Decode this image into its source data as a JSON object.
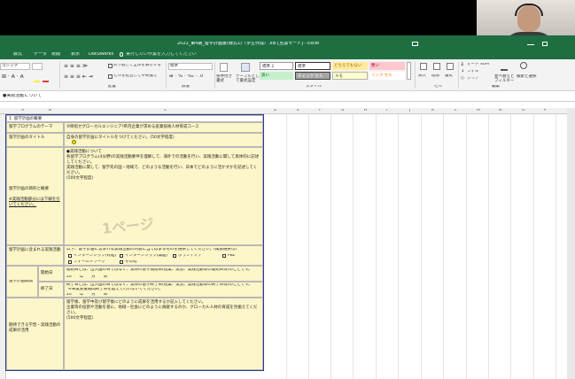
{
  "window_title": "2021_第4期_留学計画書(様式1)（学生作成）.xls [互換モード] - Excel",
  "menu": [
    "数式",
    "データ",
    "校閲",
    "表示",
    "DocuWorks",
    "実行したい作業を入力してください"
  ],
  "ribbon": {
    "font_name": "ゴシック",
    "wrap_text": "折り返して全体を表示する",
    "merge_center": "セルを結合して中央揃え",
    "number_format": "標準",
    "cond_format": "条件付き書式",
    "table_format": "テーブルとして書式設定",
    "styles": [
      "標準 2",
      "標準",
      "どちらでもない",
      "悪い",
      "良い",
      "チェック セル",
      "メモ",
      "リンク セル"
    ],
    "insert": "挿入",
    "delete": "削除",
    "format": "書式",
    "autosum": "オート SUM",
    "fill": "フィル",
    "clear": "クリア",
    "sort_filter": "並べ替えとフィルター",
    "find_select": "検索と選択",
    "groups": [
      "配置",
      "数値",
      "スタイル",
      "セル",
      "編集"
    ]
  },
  "formula_bar": "●実践活動について",
  "columns": [
    "A",
    "B",
    "C",
    "D",
    "E",
    "F",
    "G",
    "H",
    "I",
    "J",
    "K",
    "L",
    "M",
    "N",
    "O",
    "P"
  ],
  "form": {
    "section_title": "1. 留学計画の概要",
    "program_theme_label": "留学プログラムのテーマ",
    "program_theme_value": "⑩目指せグローカルエンジニア!県内企業が求める産業技術人材育成コース",
    "plan_title_label": "留学計画のタイトル",
    "plan_title_hint": "自身の留学計画にタイトルをつけてください。(50文字程度)",
    "purpose_label": "留学計画の目的と概要",
    "purpose_note": "※実践活動部分には下線を引いてください。",
    "purpose_text": "●実践活動について\n各留学プログラム(4分野)の実践活動要件を理解して、海外での活動を行い、実践活動に関して具体的に記述してください。\n実践活動に関して、留学先の国・地域で、どのような活動を行い、日本でどのように活かすかを記述してください。\n(500文字程度)",
    "page_stamp": "1ページ",
    "activities_label": "留学計画に含まれる実践活動",
    "activities_hint": "以下、留学計画に含まれる実践活動の内容に当てはまるものを選択してください。(複数選択可)",
    "checkboxes": [
      "インターンシップ(有給)",
      "インターンシップ(無給)",
      "ボランティア",
      "PBL",
      "フィールドワーク",
      "その他"
    ],
    "period_label": "留学計画期間",
    "start_label": "開始日",
    "start_hint": "開始日とは、出入国の日ではなく、実際の留学開始日(授業、実習、実践活動等の開始日等)のことです。",
    "start_date": "20　　年　　月　　日",
    "end_label": "終了日",
    "end_hint": "終了日とは、出入国の日ではなく、実際の留学終了日(授業、実習、実践活動等の終了日等)のことです。",
    "end_note": "※事業支援期間終了日を超えて行わないでください。",
    "end_date": "20　　年　　月　　日",
    "goals_label": "期待できる学習・実践活動の成果の活用",
    "goals_text": "留学後、留学中及び留学後にどのように成果を活用するか記入してください。\n企業等の役割や活動を基に、地域・社会にどのように貢献するのか、グローカル人材の育成を見据えてください。\n(500文字程度)"
  }
}
